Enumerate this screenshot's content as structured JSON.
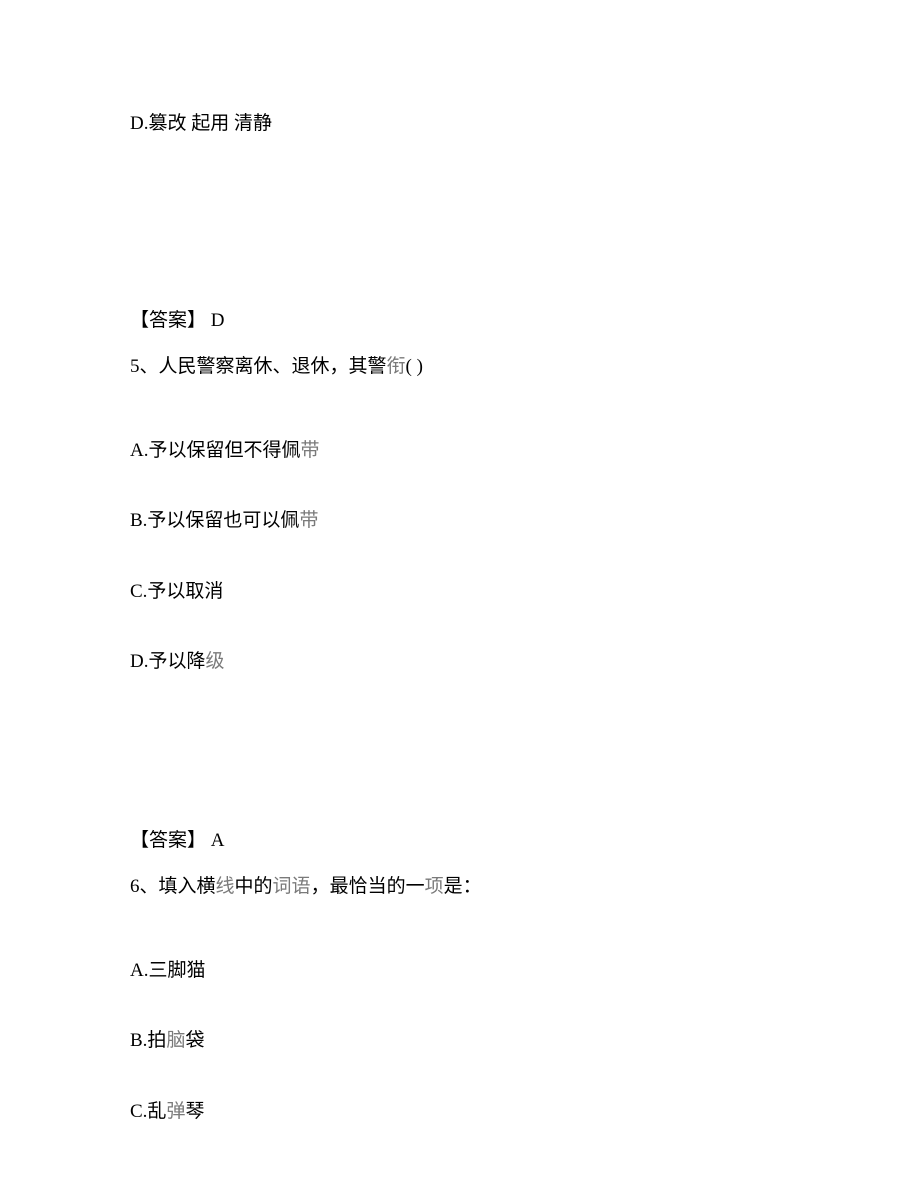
{
  "optionD_q4": "D.篡改 起用 清静",
  "answer_q4_label": "【答案】",
  "answer_q4_value": " D",
  "question5_prefix": "5、人民警察离休、退休，其警",
  "question5_gray": "衔",
  "question5_suffix": "(    )",
  "q5": {
    "a_prefix": "A.予以保留但不得佩",
    "a_gray": "带",
    "b_prefix": "B.予以保留也可以佩",
    "b_gray": "带",
    "c": "C.予以取消",
    "d_prefix": "D.予以降",
    "d_gray": "级"
  },
  "answer_q5_label": "【答案】",
  "answer_q5_value": " A",
  "question6_p1": "6、填入横",
  "question6_g1": "线",
  "question6_p2": "中的",
  "question6_g2": "词语",
  "question6_p3": "，最恰当的一",
  "question6_g3": "项",
  "question6_p4": "是：",
  "q6": {
    "a": "A.三脚猫",
    "b_prefix": "B.拍",
    "b_gray": "脑",
    "b_suffix": "袋",
    "c_prefix": "C.乱",
    "c_gray": "弹",
    "c_suffix": "琴"
  }
}
